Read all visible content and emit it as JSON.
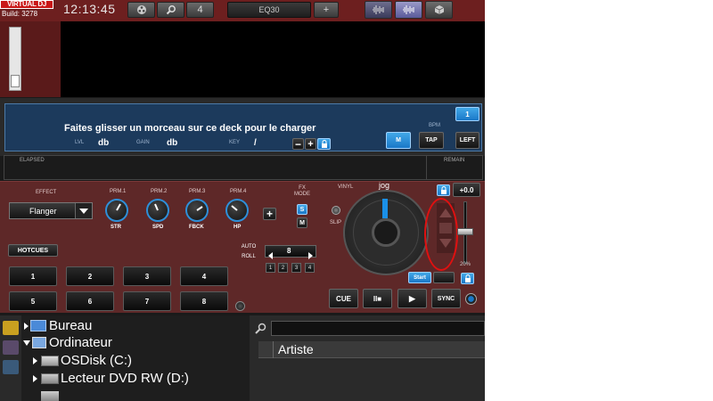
{
  "topbar": {
    "logo": "VIRTUAL DJ",
    "build": "Build: 3278",
    "clock": "12:13:45",
    "page_number": "4",
    "eq_label": "EQ30",
    "add_label": "+"
  },
  "deck": {
    "load_message": "Faites glisser un morceau sur ce deck pour le charger",
    "lvl_label": "LVL",
    "lvl_value": "db",
    "gain_label": "GAIN",
    "gain_value": "db",
    "key_label": "KEY",
    "key_value": "/",
    "bpm_label": "BPM",
    "deck_number": "1",
    "m_label": "M",
    "tap_label": "TAP",
    "left_label": "LEFT",
    "elapsed_label": "ELAPSED",
    "remain_label": "REMAIN",
    "pitch_value": "+0.0",
    "pitch_range": "20%",
    "jog_label": "jog",
    "vinyl_label": "VINYL",
    "slip_label": "SLIP",
    "start_label": "Start"
  },
  "effects": {
    "effect_label": "EFFECT",
    "selected_effect": "Flanger",
    "fx_mode_label": "FX\nMODE",
    "fx_mode_s": "S",
    "fx_mode_m": "M",
    "params": [
      {
        "label": "PRM.1",
        "name": "STR"
      },
      {
        "label": "PRM.2",
        "name": "SPD"
      },
      {
        "label": "PRM.3",
        "name": "FBCK"
      },
      {
        "label": "PRM.4",
        "name": "HP"
      }
    ]
  },
  "hotcues": {
    "title": "HOTCUES",
    "buttons": [
      "1",
      "2",
      "3",
      "4",
      "5",
      "6",
      "7",
      "8"
    ]
  },
  "autoroll": {
    "label": "AUTO\nROLL",
    "value": "8",
    "presets": [
      "1",
      "2",
      "3",
      "4"
    ]
  },
  "transport": {
    "cue": "CUE",
    "pause": "II■",
    "play": "▶",
    "sync": "SYNC"
  },
  "browser": {
    "tree": [
      {
        "label": "Bureau"
      },
      {
        "label": "Ordinateur"
      },
      {
        "label": "OSDisk (C:)"
      },
      {
        "label": "Lecteur DVD RW (D:)"
      }
    ],
    "column_artist": "Artiste"
  },
  "colors": {
    "accent_blue": "#1a78c8",
    "panel_red": "#5e2828",
    "highlight_circle": "#e01010"
  }
}
